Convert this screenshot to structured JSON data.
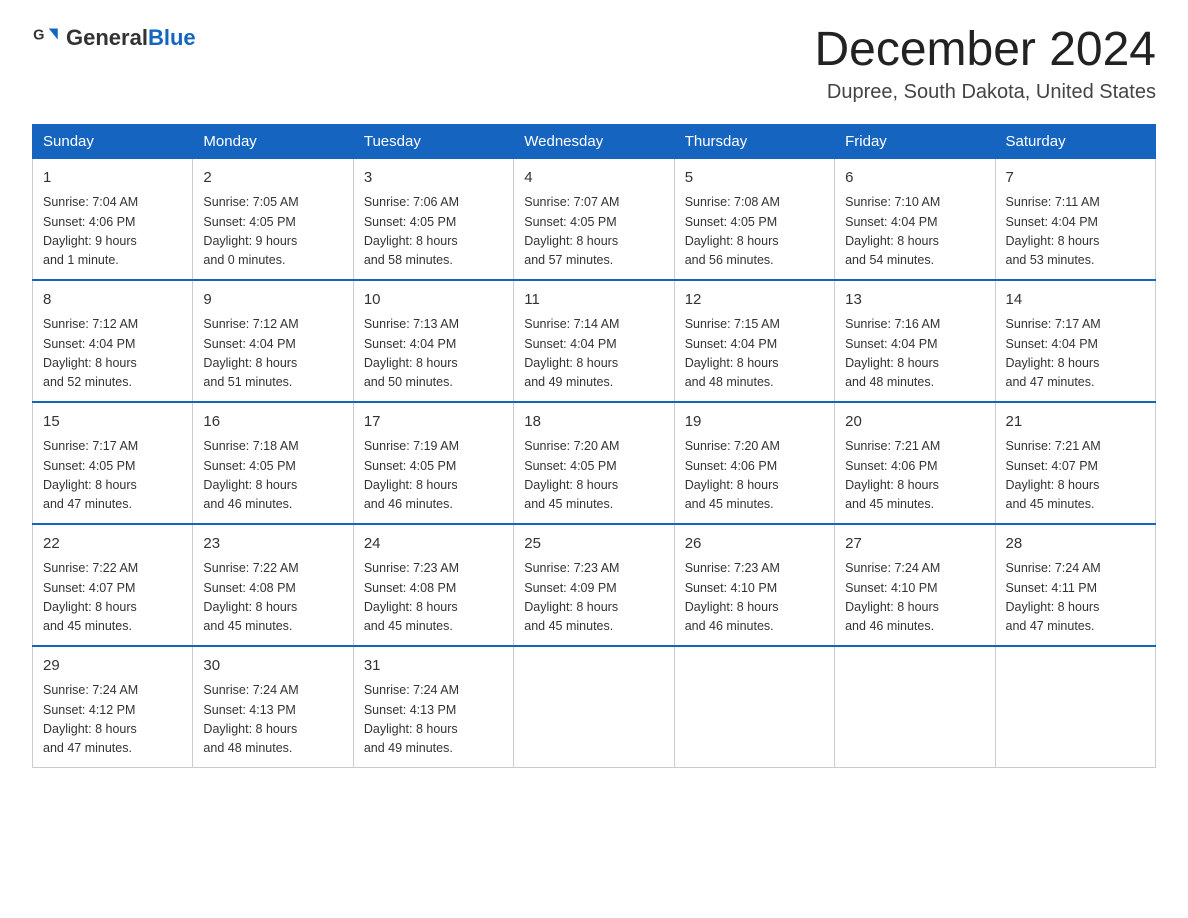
{
  "header": {
    "logo_general": "General",
    "logo_blue": "Blue",
    "month_title": "December 2024",
    "location": "Dupree, South Dakota, United States"
  },
  "days_of_week": [
    "Sunday",
    "Monday",
    "Tuesday",
    "Wednesday",
    "Thursday",
    "Friday",
    "Saturday"
  ],
  "weeks": [
    [
      {
        "day": "1",
        "sunrise": "7:04 AM",
        "sunset": "4:06 PM",
        "daylight": "9 hours and 1 minute."
      },
      {
        "day": "2",
        "sunrise": "7:05 AM",
        "sunset": "4:05 PM",
        "daylight": "9 hours and 0 minutes."
      },
      {
        "day": "3",
        "sunrise": "7:06 AM",
        "sunset": "4:05 PM",
        "daylight": "8 hours and 58 minutes."
      },
      {
        "day": "4",
        "sunrise": "7:07 AM",
        "sunset": "4:05 PM",
        "daylight": "8 hours and 57 minutes."
      },
      {
        "day": "5",
        "sunrise": "7:08 AM",
        "sunset": "4:05 PM",
        "daylight": "8 hours and 56 minutes."
      },
      {
        "day": "6",
        "sunrise": "7:10 AM",
        "sunset": "4:04 PM",
        "daylight": "8 hours and 54 minutes."
      },
      {
        "day": "7",
        "sunrise": "7:11 AM",
        "sunset": "4:04 PM",
        "daylight": "8 hours and 53 minutes."
      }
    ],
    [
      {
        "day": "8",
        "sunrise": "7:12 AM",
        "sunset": "4:04 PM",
        "daylight": "8 hours and 52 minutes."
      },
      {
        "day": "9",
        "sunrise": "7:12 AM",
        "sunset": "4:04 PM",
        "daylight": "8 hours and 51 minutes."
      },
      {
        "day": "10",
        "sunrise": "7:13 AM",
        "sunset": "4:04 PM",
        "daylight": "8 hours and 50 minutes."
      },
      {
        "day": "11",
        "sunrise": "7:14 AM",
        "sunset": "4:04 PM",
        "daylight": "8 hours and 49 minutes."
      },
      {
        "day": "12",
        "sunrise": "7:15 AM",
        "sunset": "4:04 PM",
        "daylight": "8 hours and 48 minutes."
      },
      {
        "day": "13",
        "sunrise": "7:16 AM",
        "sunset": "4:04 PM",
        "daylight": "8 hours and 48 minutes."
      },
      {
        "day": "14",
        "sunrise": "7:17 AM",
        "sunset": "4:04 PM",
        "daylight": "8 hours and 47 minutes."
      }
    ],
    [
      {
        "day": "15",
        "sunrise": "7:17 AM",
        "sunset": "4:05 PM",
        "daylight": "8 hours and 47 minutes."
      },
      {
        "day": "16",
        "sunrise": "7:18 AM",
        "sunset": "4:05 PM",
        "daylight": "8 hours and 46 minutes."
      },
      {
        "day": "17",
        "sunrise": "7:19 AM",
        "sunset": "4:05 PM",
        "daylight": "8 hours and 46 minutes."
      },
      {
        "day": "18",
        "sunrise": "7:20 AM",
        "sunset": "4:05 PM",
        "daylight": "8 hours and 45 minutes."
      },
      {
        "day": "19",
        "sunrise": "7:20 AM",
        "sunset": "4:06 PM",
        "daylight": "8 hours and 45 minutes."
      },
      {
        "day": "20",
        "sunrise": "7:21 AM",
        "sunset": "4:06 PM",
        "daylight": "8 hours and 45 minutes."
      },
      {
        "day": "21",
        "sunrise": "7:21 AM",
        "sunset": "4:07 PM",
        "daylight": "8 hours and 45 minutes."
      }
    ],
    [
      {
        "day": "22",
        "sunrise": "7:22 AM",
        "sunset": "4:07 PM",
        "daylight": "8 hours and 45 minutes."
      },
      {
        "day": "23",
        "sunrise": "7:22 AM",
        "sunset": "4:08 PM",
        "daylight": "8 hours and 45 minutes."
      },
      {
        "day": "24",
        "sunrise": "7:23 AM",
        "sunset": "4:08 PM",
        "daylight": "8 hours and 45 minutes."
      },
      {
        "day": "25",
        "sunrise": "7:23 AM",
        "sunset": "4:09 PM",
        "daylight": "8 hours and 45 minutes."
      },
      {
        "day": "26",
        "sunrise": "7:23 AM",
        "sunset": "4:10 PM",
        "daylight": "8 hours and 46 minutes."
      },
      {
        "day": "27",
        "sunrise": "7:24 AM",
        "sunset": "4:10 PM",
        "daylight": "8 hours and 46 minutes."
      },
      {
        "day": "28",
        "sunrise": "7:24 AM",
        "sunset": "4:11 PM",
        "daylight": "8 hours and 47 minutes."
      }
    ],
    [
      {
        "day": "29",
        "sunrise": "7:24 AM",
        "sunset": "4:12 PM",
        "daylight": "8 hours and 47 minutes."
      },
      {
        "day": "30",
        "sunrise": "7:24 AM",
        "sunset": "4:13 PM",
        "daylight": "8 hours and 48 minutes."
      },
      {
        "day": "31",
        "sunrise": "7:24 AM",
        "sunset": "4:13 PM",
        "daylight": "8 hours and 49 minutes."
      },
      null,
      null,
      null,
      null
    ]
  ],
  "labels": {
    "sunrise": "Sunrise:",
    "sunset": "Sunset:",
    "daylight": "Daylight:"
  }
}
